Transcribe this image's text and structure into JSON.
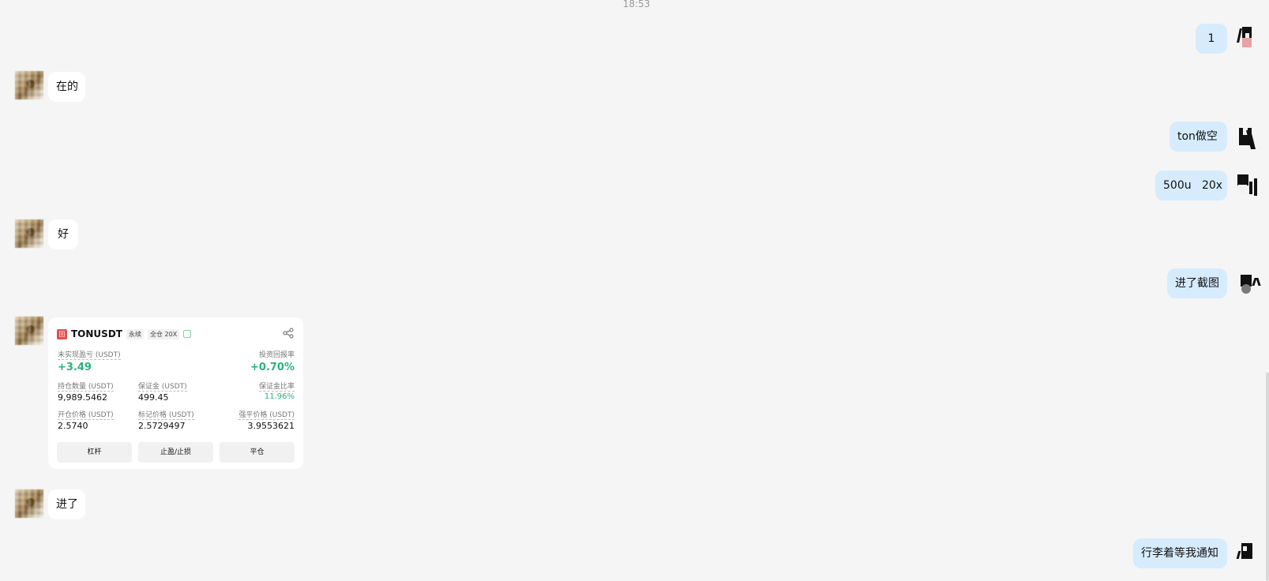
{
  "timestamp": "18:53",
  "messages": {
    "m1": "1",
    "m2": "在的",
    "m3": "ton做空",
    "m4": "500u   20x",
    "m5": "好",
    "m6": "进了截图",
    "m8": "进了",
    "m9": "行李着等我通知"
  },
  "position_card": {
    "logo_char": "回",
    "symbol": "TONUSDT",
    "tag_perpetual": "永续",
    "tag_margin": "全仓 20X",
    "share_icon": "share-icon",
    "unrealized_pnl_label": "未实现盈亏 (USDT)",
    "unrealized_pnl_value": "+3.49",
    "roi_label": "投资回报率",
    "roi_value": "+0.70%",
    "position_size_label": "持仓数量 (USDT)",
    "position_size_value": "9,989.5462",
    "margin_label": "保证金 (USDT)",
    "margin_value": "499.45",
    "margin_ratio_label": "保证金比率",
    "margin_ratio_value": "11.96%",
    "entry_price_label": "开仓价格 (USDT)",
    "entry_price_value": "2.5740",
    "mark_price_label": "标记价格 (USDT)",
    "mark_price_value": "2.5729497",
    "liq_price_label": "强平价格 (USDT)",
    "liq_price_value": "3.9553621",
    "btn_leverage": "杠杆",
    "btn_tpsl": "止盈/止损",
    "btn_close": "平仓",
    "accent_green": "#26b47a"
  }
}
